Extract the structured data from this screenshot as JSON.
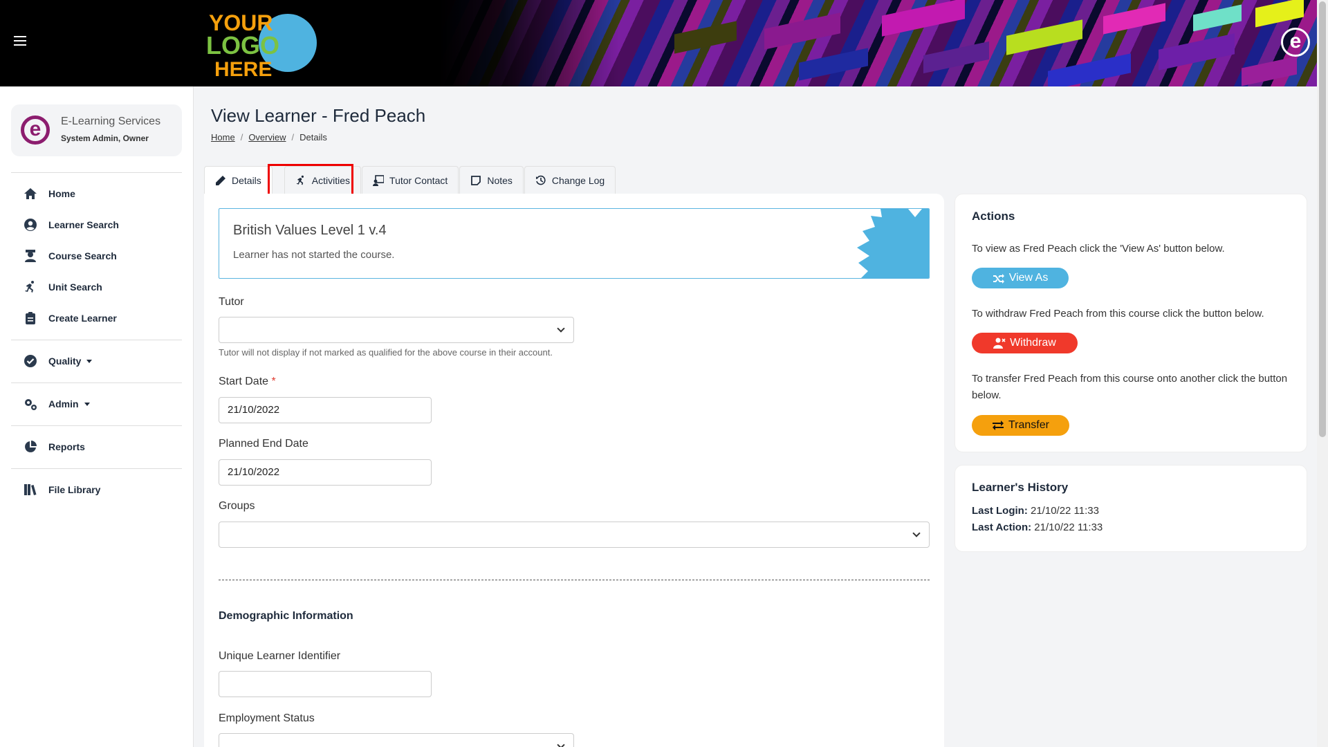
{
  "header": {
    "logo_lines": [
      "YOUR",
      "LOGO",
      "HERE"
    ],
    "brand_letter": "e"
  },
  "sidebar": {
    "org_name": "E-Learning Services",
    "user_role": "System Admin, Owner",
    "avatar_letter": "e",
    "items": [
      {
        "label": "Home",
        "icon": "home-icon"
      },
      {
        "label": "Learner Search",
        "icon": "user-circle-icon"
      },
      {
        "label": "Course Search",
        "icon": "graduate-icon"
      },
      {
        "label": "Unit Search",
        "icon": "running-icon"
      },
      {
        "label": "Create Learner",
        "icon": "clipboard-icon"
      },
      {
        "label": "Quality",
        "icon": "check-circle-icon"
      },
      {
        "label": "Admin",
        "icon": "gears-icon"
      },
      {
        "label": "Reports",
        "icon": "pie-chart-icon"
      },
      {
        "label": "File Library",
        "icon": "books-icon"
      }
    ]
  },
  "page": {
    "title": "View Learner - Fred Peach",
    "breadcrumb": [
      "Home",
      "Overview",
      "Details"
    ]
  },
  "tabs": [
    {
      "label": "Details",
      "icon": "pencil-icon",
      "active": true
    },
    {
      "label": "Activities",
      "icon": "running-icon",
      "active": false
    },
    {
      "label": "Tutor Contact",
      "icon": "chalkboard-icon",
      "active": false
    },
    {
      "label": "Notes",
      "icon": "note-icon",
      "active": false
    },
    {
      "label": "Change Log",
      "icon": "history-icon",
      "active": false
    }
  ],
  "course": {
    "title": "British Values Level 1 v.4",
    "status": "Learner has not started the course.",
    "badge_color": "#4fb3e0"
  },
  "form": {
    "tutor_label": "Tutor",
    "tutor_value": "",
    "tutor_help": "Tutor will not display if not marked as qualified for the above course in their account.",
    "start_date_label": "Start Date",
    "required_mark": "*",
    "start_date_value": "21/10/2022",
    "end_date_label": "Planned End Date",
    "end_date_value": "21/10/2022",
    "groups_label": "Groups",
    "groups_value": "",
    "demographic_heading": "Demographic Information",
    "uli_label": "Unique Learner Identifier",
    "uli_value": "",
    "employment_label": "Employment Status",
    "employment_value": ""
  },
  "actions": {
    "heading": "Actions",
    "view_as_text": "To view as Fred Peach click the 'View As' button below.",
    "view_as_button": "View As",
    "withdraw_text": "To withdraw Fred Peach from this course click the button below.",
    "withdraw_button": "Withdraw",
    "transfer_text": "To transfer Fred Peach from this course onto another click the button below.",
    "transfer_button": "Transfer",
    "colors": {
      "view_as": "#4fb3e0",
      "withdraw": "#f0392b",
      "transfer": "#f5a00d"
    }
  },
  "history": {
    "heading": "Learner's History",
    "last_login_label": "Last Login:",
    "last_login_value": "21/10/22 11:33",
    "last_action_label": "Last Action:",
    "last_action_value": "21/10/22 11:33"
  }
}
